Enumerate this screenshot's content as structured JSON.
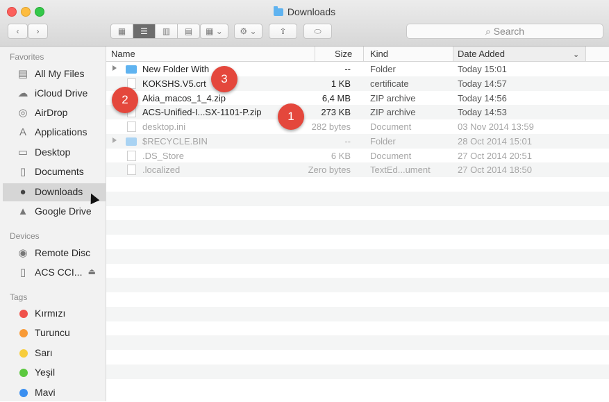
{
  "window": {
    "title": "Downloads"
  },
  "toolbar": {
    "back_icon": "chevron-left",
    "forward_icon": "chevron-right",
    "view_icons": [
      "grid",
      "list",
      "columns",
      "cover-flow"
    ],
    "arrange_icon": "arrange-grid",
    "action_icon": "gear",
    "share_icon": "share",
    "tag_icon": "tag",
    "search_placeholder": "Search"
  },
  "sidebar": {
    "favorites_label": "Favorites",
    "favorites": [
      {
        "label": "All My Files",
        "icon": "files-icon"
      },
      {
        "label": "iCloud Drive",
        "icon": "cloud-icon"
      },
      {
        "label": "AirDrop",
        "icon": "airdrop-icon"
      },
      {
        "label": "Applications",
        "icon": "applications-icon"
      },
      {
        "label": "Desktop",
        "icon": "desktop-icon"
      },
      {
        "label": "Documents",
        "icon": "documents-icon"
      },
      {
        "label": "Downloads",
        "icon": "downloads-icon",
        "selected": true
      },
      {
        "label": "Google Drive",
        "icon": "google-drive-icon"
      }
    ],
    "devices_label": "Devices",
    "devices": [
      {
        "label": "Remote Disc",
        "icon": "disc-icon"
      },
      {
        "label": "ACS CCI...",
        "icon": "drive-icon"
      }
    ],
    "tags_label": "Tags",
    "tags": [
      {
        "label": "Kırmızı",
        "color": "#f0524b"
      },
      {
        "label": "Turuncu",
        "color": "#f89a36"
      },
      {
        "label": "Sarı",
        "color": "#f7cd3c"
      },
      {
        "label": "Yeşil",
        "color": "#5cc83f"
      },
      {
        "label": "Mavi",
        "color": "#3b8ff0"
      }
    ]
  },
  "columns": {
    "name": "Name",
    "size": "Size",
    "kind": "Kind",
    "date": "Date Added"
  },
  "files": [
    {
      "name": "New Folder With",
      "size": "--",
      "kind": "Folder",
      "date": "Today 15:01"
    },
    {
      "name": "KOKSHS.V5.crt",
      "size": "1 KB",
      "kind": "certificate",
      "date": "Today 14:57"
    },
    {
      "name": "Akia_macos_1_4.zip",
      "size": "6,4 MB",
      "kind": "ZIP archive",
      "date": "Today 14:56"
    },
    {
      "name": "ACS-Unified-I...SX-1101-P.zip",
      "size": "273 KB",
      "kind": "ZIP archive",
      "date": "Today 14:53"
    },
    {
      "name": "desktop.ini",
      "size": "282 bytes",
      "kind": "Document",
      "date": "03 Nov 2014 13:59"
    },
    {
      "name": "$RECYCLE.BIN",
      "size": "--",
      "kind": "Folder",
      "date": "28 Oct 2014 15:01"
    },
    {
      "name": ".DS_Store",
      "size": "6 KB",
      "kind": "Document",
      "date": "27 Oct 2014 20:51"
    },
    {
      "name": ".localized",
      "size": "Zero bytes",
      "kind": "TextEd...ument",
      "date": "27 Oct 2014 18:50"
    }
  ],
  "markers": [
    "1",
    "2",
    "3"
  ]
}
